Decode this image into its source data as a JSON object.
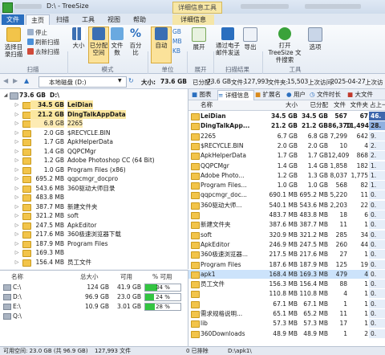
{
  "window": {
    "title": "D:\\ - TreeSize",
    "context_tab_header": "详细信息工具"
  },
  "ribbon_tabs": [
    "文件",
    "主页",
    "扫描",
    "工具",
    "视图",
    "帮助",
    "详细信息"
  ],
  "ribbon": {
    "scan_group": {
      "label": "扫描",
      "select_dir": "选择目录扫描",
      "stop": "停止",
      "rescan": "刷新扫描",
      "remove_scan": "去除扫描"
    },
    "mode_group": {
      "label": "模式",
      "size": "大小",
      "allocated": "已分配空间",
      "file_count": "文件数",
      "percent": "百分比"
    },
    "unit_group": {
      "label": "单位",
      "auto": "自动",
      "gb": "GB",
      "mb": "MB",
      "kb": "KB"
    },
    "expand_group": {
      "label": "展开",
      "expand": "展开"
    },
    "results_group": {
      "label": "扫描结果",
      "email": "通过电子邮件发送",
      "export": "导出"
    },
    "tools_group": {
      "label": "工具",
      "open": "打开 TreeSize 文件搜索",
      "options": "选项"
    }
  },
  "address": {
    "path": "本地磁盘 (D:)",
    "size_label": "大小:",
    "size_value": "73.6 GB",
    "allocated_label": "已分配:",
    "allocated_value": "73.6 GB",
    "files_label": "文件:",
    "files_value": "127,993",
    "folders_label": "文件夹:",
    "folders_value": "15,503",
    "updated_label": "上次访问:",
    "updated_value": "2025-04-27",
    "trailing": "上次访"
  },
  "tree": {
    "root": {
      "size": "73.6 GB",
      "name": "D:\\"
    },
    "rows": [
      {
        "size": "34.5 GB",
        "name": "LeiDian",
        "hl": "hl"
      },
      {
        "size": "21.2 GB",
        "name": "DingTalkAppData",
        "hl": "hl"
      },
      {
        "size": "6.8 GB",
        "name": "2265",
        "hl": "hl2"
      },
      {
        "size": "2.0 GB",
        "name": "$RECYCLE.BIN",
        "hl": ""
      },
      {
        "size": "1.7 GB",
        "name": "ApkHelperData",
        "hl": ""
      },
      {
        "size": "1.4 GB",
        "name": "QQPCMgr",
        "hl": ""
      },
      {
        "size": "1.2 GB",
        "name": "Adobe Photoshop CC (64 Bit)",
        "hl": ""
      },
      {
        "size": "1.0 GB",
        "name": "Program Files (x86)",
        "hl": ""
      },
      {
        "size": "695.2 MB",
        "name": "qqpcmgr_docpro",
        "hl": ""
      },
      {
        "size": "543.6 MB",
        "name": "360驱动大师目录",
        "hl": ""
      },
      {
        "size": "483.8 MB",
        "name": "",
        "hl": ""
      },
      {
        "size": "387.7 MB",
        "name": "新建文件夹",
        "hl": ""
      },
      {
        "size": "321.2 MB",
        "name": "soft",
        "hl": ""
      },
      {
        "size": "247.5 MB",
        "name": "ApkEditor",
        "hl": ""
      },
      {
        "size": "217.6 MB",
        "name": "360极速浏览器下载",
        "hl": ""
      },
      {
        "size": "187.9 MB",
        "name": "Program Files",
        "hl": ""
      },
      {
        "size": "169.3 MB",
        "name": "",
        "hl": ""
      },
      {
        "size": "156.4 MB",
        "name": "员工文件",
        "hl": ""
      }
    ]
  },
  "drives": {
    "headers": {
      "name": "名称",
      "total": "总大小",
      "free": "可用",
      "pct": "% 可用"
    },
    "rows": [
      {
        "name": "C:\\",
        "total": "124 GB",
        "free": "41.9 GB",
        "pct": "34 %",
        "fill": 0.34
      },
      {
        "name": "D:\\",
        "total": "96.9 GB",
        "free": "23.0 GB",
        "pct": "24 %",
        "fill": 0.24
      },
      {
        "name": "E:\\",
        "total": "10.9 GB",
        "free": "3.01 GB",
        "pct": "28 %",
        "fill": 0.28
      },
      {
        "name": "Q:\\",
        "total": "",
        "free": "",
        "pct": "",
        "fill": 0
      }
    ]
  },
  "details": {
    "tabs": [
      "图表",
      "详细信息",
      "扩展名",
      "用户",
      "文件时长",
      "大文件"
    ],
    "headers": {
      "name": "名称",
      "size": "大小",
      "alloc": "已分配",
      "files": "文件",
      "folders": "文件夹",
      "pct": "占上一"
    },
    "rows": [
      {
        "name": "LeiDian",
        "size": "34.5 GB",
        "alloc": "34.5 GB",
        "files": "567",
        "folders": "67",
        "pct": "46.",
        "bold": true,
        "sel": false
      },
      {
        "name": "DingTalkApp...",
        "size": "21.2 GB",
        "alloc": "21.2 GB",
        "files": "86,370",
        "folders": "11,494",
        "pct": "28.",
        "bold": true,
        "sel": false
      },
      {
        "name": "2265",
        "size": "6.7 GB",
        "alloc": "6.8 GB",
        "files": "7,299",
        "folders": "642",
        "pct": "9.",
        "bold": false,
        "sel": false
      },
      {
        "name": "$RECYCLE.BIN",
        "size": "2.0 GB",
        "alloc": "2.0 GB",
        "files": "10",
        "folders": "4",
        "pct": "2.",
        "bold": false,
        "sel": false
      },
      {
        "name": "ApkHelperData",
        "size": "1.7 GB",
        "alloc": "1.7 GB",
        "files": "12,409",
        "folders": "868",
        "pct": "2.",
        "bold": false,
        "sel": false
      },
      {
        "name": "QQPCMgr",
        "size": "1.4 GB",
        "alloc": "1.4 GB",
        "files": "1,858",
        "folders": "182",
        "pct": "1.",
        "bold": false,
        "sel": false
      },
      {
        "name": "Adobe Photo...",
        "size": "1.2 GB",
        "alloc": "1.3 GB",
        "files": "8,037",
        "folders": "1,775",
        "pct": "1.",
        "bold": false,
        "sel": false
      },
      {
        "name": "Program Files...",
        "size": "1.0 GB",
        "alloc": "1.0 GB",
        "files": "568",
        "folders": "82",
        "pct": "1.",
        "bold": false,
        "sel": false
      },
      {
        "name": "qqpcmgr_doc...",
        "size": "690.1 MB",
        "alloc": "695.2 MB",
        "files": "5,220",
        "folders": "11",
        "pct": "0.",
        "bold": false,
        "sel": false
      },
      {
        "name": "360驱动大师...",
        "size": "540.1 MB",
        "alloc": "543.6 MB",
        "files": "2,203",
        "folders": "22",
        "pct": "0.",
        "bold": false,
        "sel": false
      },
      {
        "name": "",
        "size": "483.7 MB",
        "alloc": "483.8 MB",
        "files": "18",
        "folders": "6",
        "pct": "0.",
        "bold": false,
        "sel": false
      },
      {
        "name": "新建文件夹",
        "size": "387.6 MB",
        "alloc": "387.7 MB",
        "files": "11",
        "folders": "1",
        "pct": "0.",
        "bold": false,
        "sel": false
      },
      {
        "name": "soft",
        "size": "320.9 MB",
        "alloc": "321.2 MB",
        "files": "285",
        "folders": "34",
        "pct": "0.",
        "bold": false,
        "sel": false
      },
      {
        "name": "ApkEditor",
        "size": "246.9 MB",
        "alloc": "247.5 MB",
        "files": "260",
        "folders": "44",
        "pct": "0.",
        "bold": false,
        "sel": false
      },
      {
        "name": "360极速浏览器...",
        "size": "217.5 MB",
        "alloc": "217.6 MB",
        "files": "27",
        "folders": "1",
        "pct": "0.",
        "bold": false,
        "sel": false
      },
      {
        "name": "Program Files",
        "size": "187.6 MB",
        "alloc": "187.9 MB",
        "files": "125",
        "folders": "19",
        "pct": "0.",
        "bold": false,
        "sel": false
      },
      {
        "name": "apk1",
        "size": "168.4 MB",
        "alloc": "169.3 MB",
        "files": "479",
        "folders": "4",
        "pct": "0.",
        "bold": false,
        "sel": true
      },
      {
        "name": "员工文件",
        "size": "156.3 MB",
        "alloc": "156.4 MB",
        "files": "88",
        "folders": "1",
        "pct": "0.",
        "bold": false,
        "sel": false
      },
      {
        "name": "",
        "size": "110.8 MB",
        "alloc": "110.8 MB",
        "files": "4",
        "folders": "1",
        "pct": "0.",
        "bold": false,
        "sel": false
      },
      {
        "name": "",
        "size": "67.1 MB",
        "alloc": "67.1 MB",
        "files": "1",
        "folders": "1",
        "pct": "0.",
        "bold": false,
        "sel": false
      },
      {
        "name": "需求规格说明...",
        "size": "65.1 MB",
        "alloc": "65.2 MB",
        "files": "11",
        "folders": "1",
        "pct": "0.",
        "bold": false,
        "sel": false
      },
      {
        "name": "lib",
        "size": "57.3 MB",
        "alloc": "57.3 MB",
        "files": "17",
        "folders": "1",
        "pct": "0.",
        "bold": false,
        "sel": false
      },
      {
        "name": "360Downloads",
        "size": "48.9 MB",
        "alloc": "48.9 MB",
        "files": "1",
        "folders": "2",
        "pct": "0.",
        "bold": false,
        "sel": false
      }
    ]
  },
  "status": {
    "free": "可用空间: 23.0 GB (共 96.9 GB)",
    "files": "127,993 文件",
    "excluded": "0 已排除",
    "path": "D:\\apk1\\"
  },
  "colors": {
    "accent": "#2b6fbf",
    "highlight": "#fbe7a0",
    "selection": "#cce3fb",
    "free_bar": "#33c441"
  }
}
